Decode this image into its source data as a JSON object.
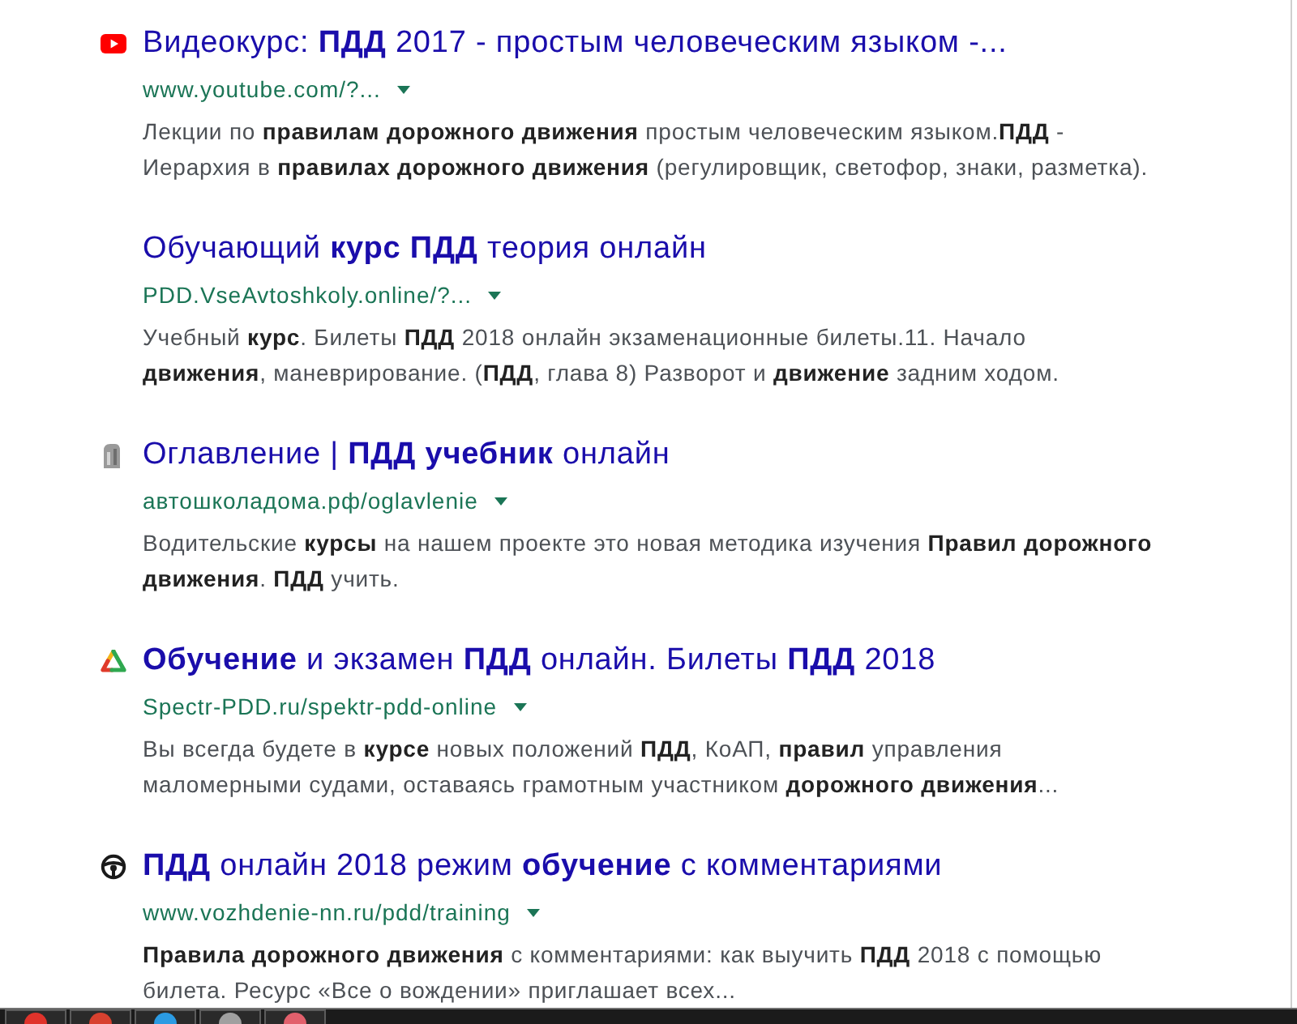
{
  "results": [
    {
      "favicon": {
        "kind": "video"
      },
      "title": "Видеокурс: **ПДД** 2017 - простым человеческим языком -...",
      "url": "www.youtube.com/?...",
      "snippet_lines": [
        "Лекции по **правилам дорожного движения** простым человеческим языком.**ПДД** -",
        "Иерархия в **правилах дорожного движения** (регулировщик, светофор, знаки, разметка)."
      ]
    },
    {
      "title": "Обучающий **курс ПДД** теория онлайн",
      "url": "PDD.VseAvtoshkoly.online/?...",
      "snippet_lines": [
        "Учебный **курс**. Билеты **ПДД** 2018 онлайн экзаменационные билеты.11. Начало",
        "**движения**, маневрирование. (**ПДД**, глава 8) Разворот и **движение** задним ходом."
      ]
    },
    {
      "favicon": {
        "kind": "site"
      },
      "title": "Оглавление | **ПДД учебник** онлайн",
      "url": "автошколадома.рф/oglavlenie",
      "snippet_lines": [
        "Водительские **курсы** на нашем проекте это новая методика изучения **Правил дорожного**",
        "**движения**. **ПДД** учить."
      ]
    },
    {
      "favicon": {
        "kind": "triangle"
      },
      "title": "**Обучение** и экзамен **ПДД** онлайн. Билеты **ПДД** 2018",
      "url": "Spectr-PDD.ru/spektr-pdd-online",
      "snippet_lines": [
        "Вы всегда будете в **курсе** новых положений **ПДД**, КоАП, **правил** управления",
        "маломерными судами, оставаясь грамотным участником **дорожного движения**..."
      ]
    },
    {
      "favicon": {
        "kind": "wheel"
      },
      "title": "**ПДД** онлайн 2018 режим **обучение** с комментариями",
      "url": "www.vozhdenie-nn.ru/pdd/training",
      "snippet_lines": [
        "**Правила дорожного движения** с комментариями: как выучить **ПДД** 2018 с помощью",
        "билета. Ресурс «Все о вождении» приглашает всех..."
      ]
    }
  ],
  "taskbar": {
    "items": [
      {
        "color": "#e0332b"
      },
      {
        "color": "#d8412f"
      },
      {
        "color": "#2b9be3"
      },
      {
        "color": "#a0a0a0"
      },
      {
        "color": "#e2606c"
      }
    ]
  }
}
